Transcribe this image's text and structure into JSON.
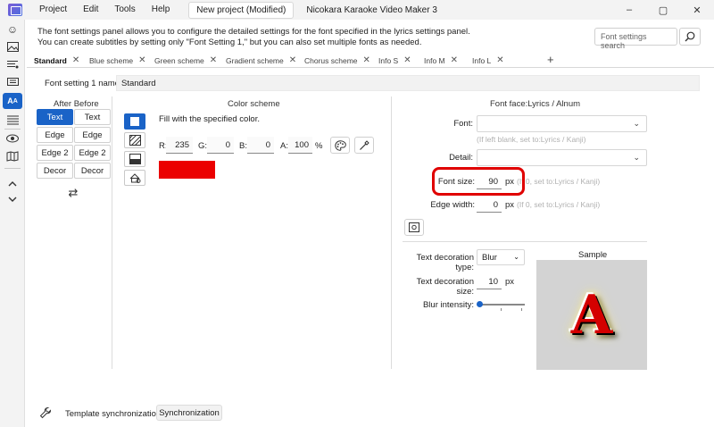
{
  "titlebar": {
    "menu": [
      "Project",
      "Edit",
      "Tools",
      "Help"
    ],
    "document_title": "New project (Modified)",
    "app_title": "Nicokara Karaoke Video Maker 3",
    "controls": [
      "–",
      "▢",
      "✕"
    ]
  },
  "info": {
    "line1": "The font settings panel allows you to configure the detailed settings for the font specified in the lyrics settings panel.",
    "line2": "You can create subtitles by setting only \"Font Setting 1,\" but you can also set multiple fonts as needed."
  },
  "search": {
    "placeholder": "Font settings search"
  },
  "tabs": [
    {
      "label": "Standard",
      "active": true
    },
    {
      "label": "Blue scheme"
    },
    {
      "label": "Green scheme"
    },
    {
      "label": "Gradient scheme"
    },
    {
      "label": "Chorus scheme"
    },
    {
      "label": "Info S"
    },
    {
      "label": "Info M"
    },
    {
      "label": "Info L"
    }
  ],
  "tab_add": "+",
  "font_setting": {
    "label": "Font setting 1 name:",
    "value": "Standard"
  },
  "after_before": {
    "title": "After Before",
    "buttons": [
      [
        "Text",
        "Text"
      ],
      [
        "Edge",
        "Edge"
      ],
      [
        "Edge 2",
        "Edge 2"
      ],
      [
        "Decor",
        "Decor"
      ]
    ],
    "swap_icon": "swap-icon"
  },
  "color_scheme": {
    "title": "Color scheme",
    "description": "Fill with the specified color.",
    "r_label": "R:",
    "r": "235",
    "g_label": "G:",
    "g": "0",
    "b_label": "B:",
    "b": "0",
    "a_label": "A:",
    "a": "100",
    "a_unit": "%",
    "swatch_color": "#eb0000"
  },
  "font_face": {
    "title": "Font face:Lyrics / Alnum",
    "font_label": "Font:",
    "font_value": "",
    "font_hint": "(If left blank, set to:Lyrics / Kanji)",
    "detail_label": "Detail:",
    "detail_value": "",
    "size_label": "Font size:",
    "size_value": "90",
    "size_unit": "px",
    "size_hint": "(If 0, set to:Lyrics / Kanji)",
    "edge_label": "Edge width:",
    "edge_value": "0",
    "edge_unit": "px",
    "edge_hint": "(If 0, set to:Lyrics / Kanji)"
  },
  "decoration": {
    "type_label": "Text decoration type:",
    "type_value": "Blur",
    "size_label": "Text decoration size:",
    "size_value": "10",
    "size_unit": "px",
    "blur_label": "Blur intensity:",
    "blur_level": 0
  },
  "sample": {
    "title": "Sample",
    "glyph": "A"
  },
  "template_sync": {
    "label": "Template synchronization:",
    "button": "Synchronization"
  },
  "colors": {
    "accent": "#1a63c7",
    "highlight": "#e00000"
  }
}
